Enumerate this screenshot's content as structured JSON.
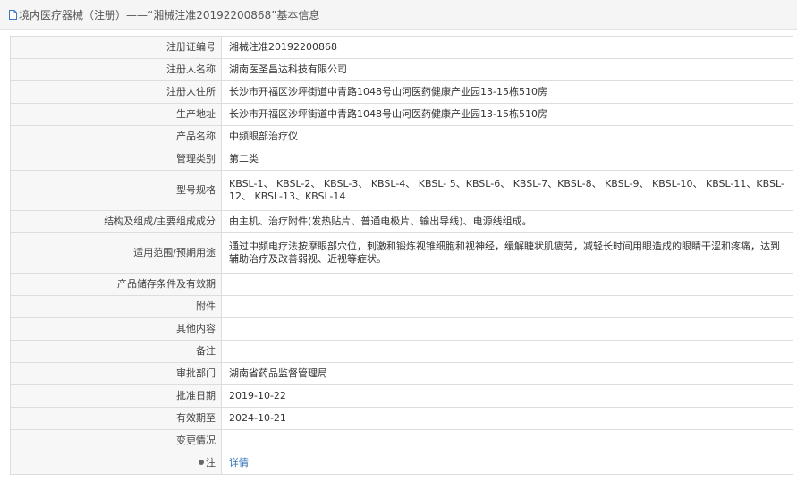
{
  "header": {
    "title": "境内医疗器械（注册）——“湘械注准20192200868”基本信息"
  },
  "rows": [
    {
      "label": "注册证编号",
      "value": "湘械注准20192200868"
    },
    {
      "label": "注册人名称",
      "value": "湖南医圣昌达科技有限公司"
    },
    {
      "label": "注册人住所",
      "value": "长沙市开福区沙坪街道中青路1048号山河医药健康产业园13-15栋510房"
    },
    {
      "label": "生产地址",
      "value": "长沙市开福区沙坪街道中青路1048号山河医药健康产业园13-15栋510房"
    },
    {
      "label": "产品名称",
      "value": "中频眼部治疗仪"
    },
    {
      "label": "管理类别",
      "value": "第二类"
    },
    {
      "label": "型号规格",
      "value": "KBSL-1、 KBSL-2、 KBSL-3、 KBSL-4、 KBSL- 5、KBSL-6、 KBSL-7、KBSL-8、 KBSL-9、 KBSL-10、 KBSL-11、KBSL-12、 KBSL-13、KBSL-14"
    },
    {
      "label": "结构及组成/主要组成成分",
      "value": "由主机、治疗附件(发热贴片、普通电极片、输出导线)、电源线组成。"
    },
    {
      "label": "适用范围/预期用途",
      "value": "通过中频电疗法按摩眼部穴位，刺激和锻炼视锥细胞和视神经，缓解睫状肌疲劳，减轻长时间用眼造成的眼睛干涩和疼痛，达到辅助治疗及改善弱视、近视等症状。"
    },
    {
      "label": "产品储存条件及有效期",
      "value": ""
    },
    {
      "label": "附件",
      "value": ""
    },
    {
      "label": "其他内容",
      "value": ""
    },
    {
      "label": "备注",
      "value": ""
    },
    {
      "label": "审批部门",
      "value": "湖南省药品监督管理局"
    },
    {
      "label": "批准日期",
      "value": "2019-10-22"
    },
    {
      "label": "有效期至",
      "value": "2024-10-21"
    },
    {
      "label": "变更情况",
      "value": ""
    },
    {
      "label": "注",
      "value": "详情",
      "icon": "pin-icon"
    }
  ]
}
